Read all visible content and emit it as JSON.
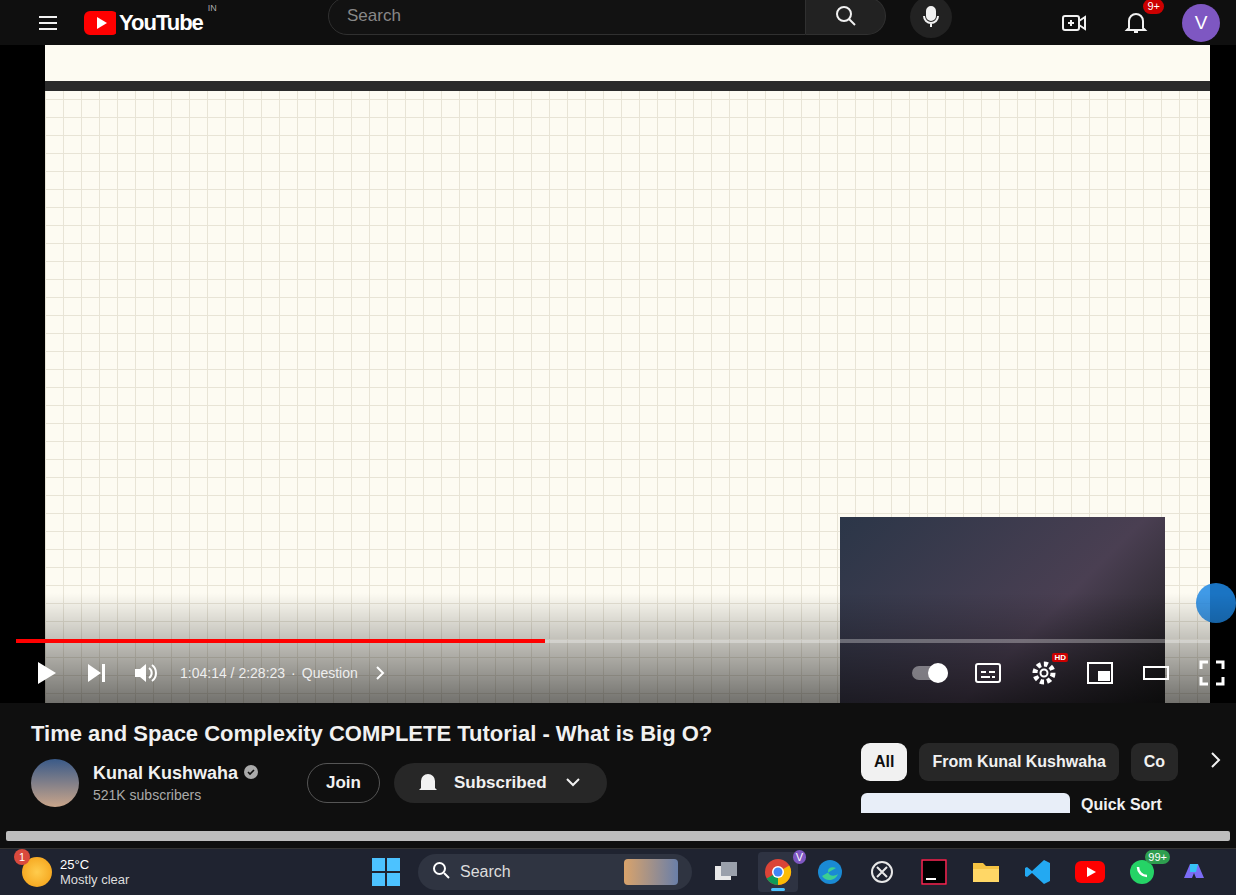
{
  "header": {
    "logo": "YouTube",
    "country": "IN",
    "search": {
      "placeholder": "Search"
    },
    "notifications": "9+",
    "avatar": "V"
  },
  "player": {
    "playing": false,
    "progress": {
      "level": 0.443
    },
    "time": "1:04:14 / 2:28:23",
    "separator": "·",
    "chapter": "Question",
    "autoplay": {
      "on": true
    },
    "hd_badge": "HD"
  },
  "video": {
    "title": "Time and Space Complexity COMPLETE Tutorial - What is Big O?",
    "channel": {
      "name": "Kunal Kushwaha",
      "verified": true,
      "subscribers": "521K subscribers"
    },
    "join": "Join",
    "subscribe": {
      "label": "Subscribed",
      "subscribed": true
    }
  },
  "chips": [
    {
      "label": "All",
      "selected": true
    },
    {
      "label": "From Kunal Kushwaha",
      "selected": false
    },
    {
      "label": "Co",
      "selected": false
    }
  ],
  "recommendation": {
    "title": "Quick Sort"
  },
  "taskbar": {
    "weather": {
      "temp": "25°C",
      "condition": "Mostly clear",
      "badge": "1"
    },
    "search": {
      "placeholder": "Search"
    },
    "apps": [
      {
        "kind": "taskview",
        "active": false
      },
      {
        "kind": "chrome",
        "active": true,
        "badge": "V"
      },
      {
        "kind": "edge",
        "active": false
      },
      {
        "kind": "chatgpt",
        "active": false
      },
      {
        "kind": "intellij",
        "active": false
      },
      {
        "kind": "explorer",
        "active": false
      },
      {
        "kind": "vscode",
        "active": false
      },
      {
        "kind": "youtube",
        "active": false
      },
      {
        "kind": "whatsapp",
        "active": false,
        "badge": "99+"
      },
      {
        "kind": "copilot",
        "active": false
      }
    ]
  }
}
